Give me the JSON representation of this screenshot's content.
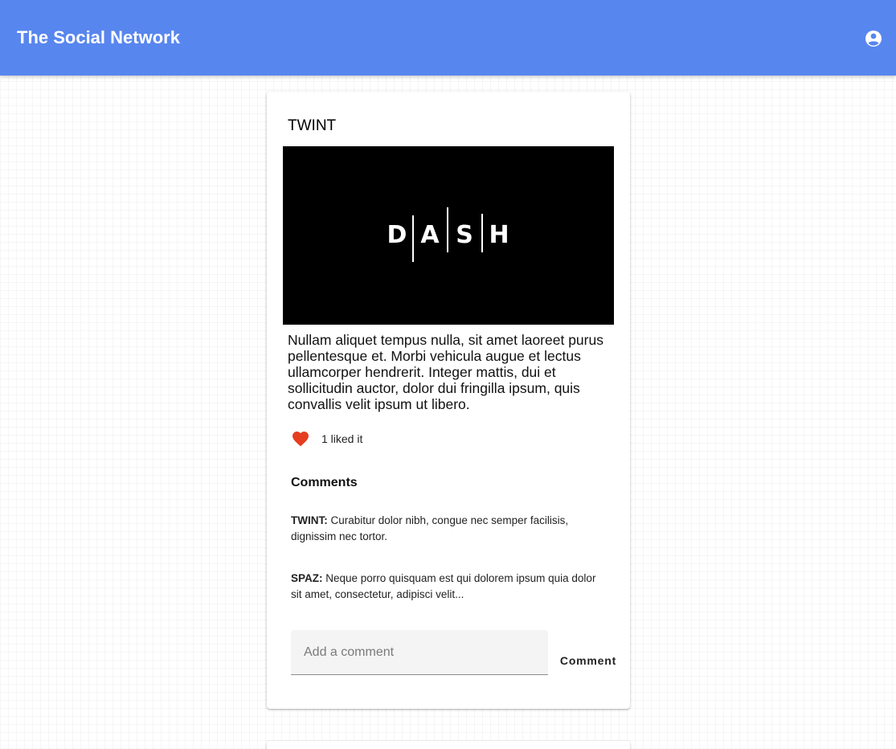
{
  "app": {
    "title": "The Social Network",
    "account_icon": "account-circle-icon",
    "appbar_color": "#5886ef"
  },
  "post": {
    "author": "TWINT",
    "image": {
      "logo_letters": [
        "D",
        "A",
        "S",
        "H"
      ]
    },
    "text": "Nullam aliquet tempus nulla, sit amet laoreet purus pellentesque et. Morbi vehicula augue et lectus ullamcorper hendrerit. Integer mattis, dui et sollicitudin auctor, dolor dui fringilla ipsum, quis convallis velit ipsum ut libero.",
    "likes": {
      "icon": "heart-icon",
      "color": "#e53d1f",
      "label": "1 liked it"
    },
    "comments_heading": "Comments",
    "comments": [
      {
        "author": "TWINT:",
        "text": " Curabitur dolor nibh, congue nec semper facilisis, dignissim nec tortor."
      },
      {
        "author": "SPAZ:",
        "text": " Neque porro quisquam est qui dolorem ipsum quia dolor sit amet, consectetur, adipisci velit..."
      }
    ],
    "comment_input": {
      "placeholder": "Add a comment",
      "value": ""
    },
    "comment_button_label": "Comment"
  }
}
